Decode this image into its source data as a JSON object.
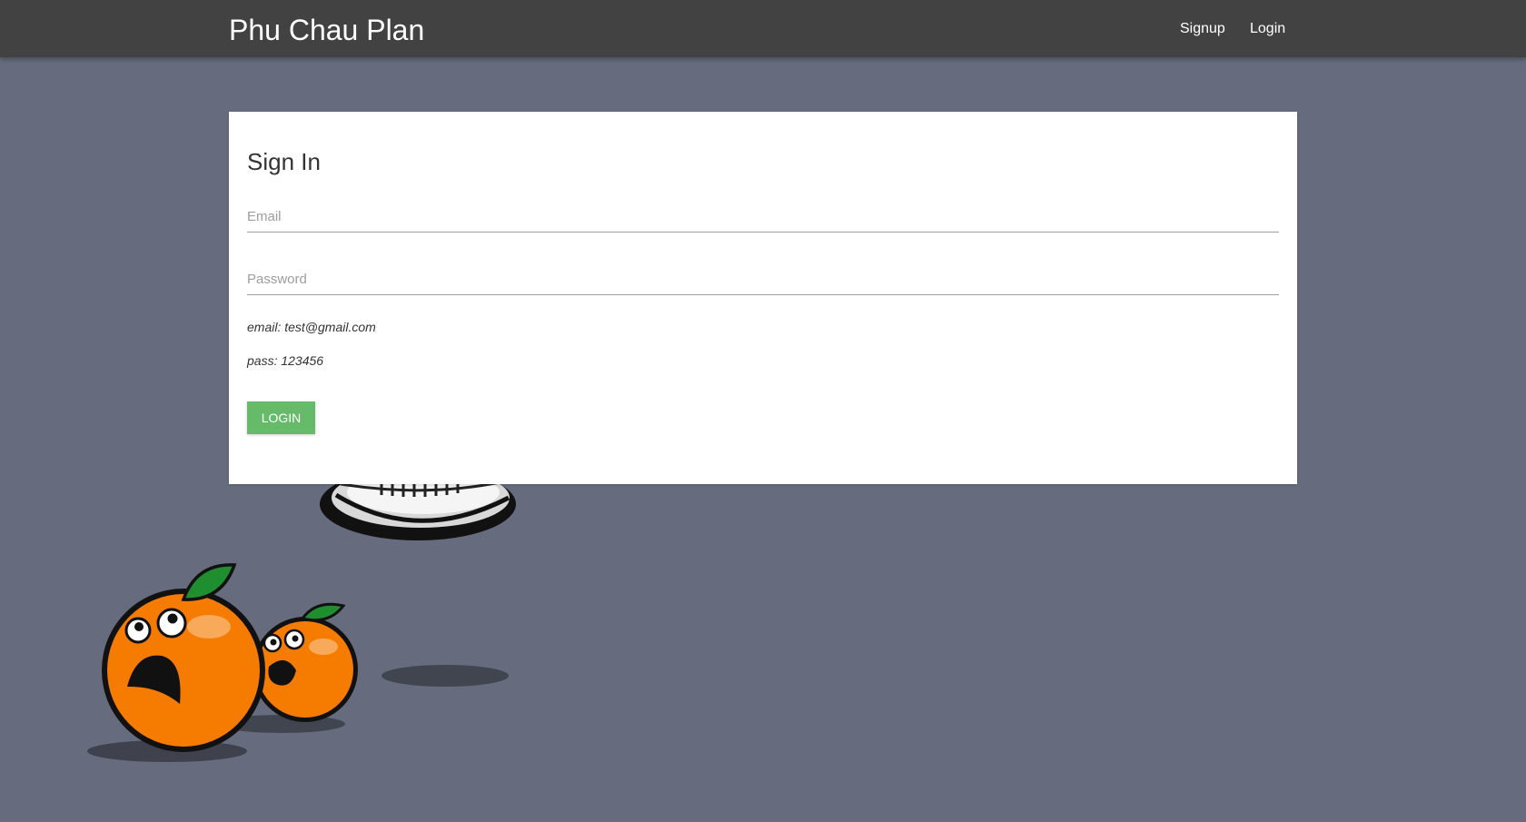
{
  "navbar": {
    "brand": "Phu Chau Plan",
    "links": [
      "Signup",
      "Login"
    ]
  },
  "signin": {
    "title": "Sign In",
    "email_placeholder": "Email",
    "password_placeholder": "Password",
    "email_value": "",
    "password_value": "",
    "hint_email": "email: test@gmail.com",
    "hint_pass": "pass: 123456",
    "login_label": "LOGIN"
  },
  "colors": {
    "background": "#666c7e",
    "navbar": "#424242",
    "button": "#66bb6a",
    "orange": "#f57c00",
    "leaf": "#1e8e2f"
  },
  "illustration": {
    "icons": [
      "juicer-bowl-icon",
      "orange-character-large-icon",
      "orange-character-small-icon"
    ]
  }
}
